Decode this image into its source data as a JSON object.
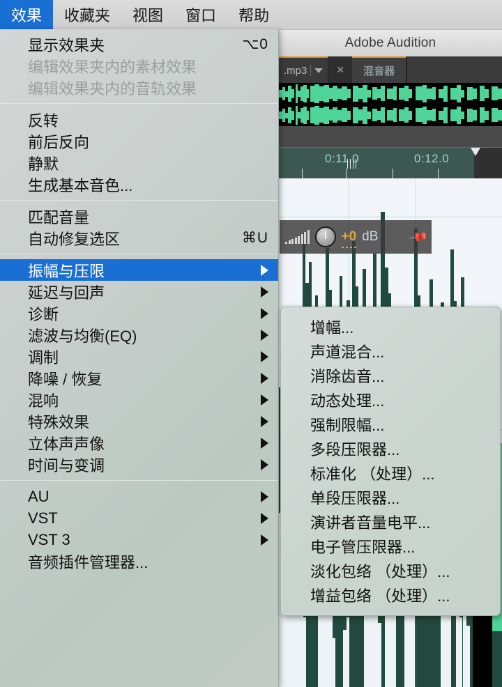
{
  "menubar": {
    "items": [
      {
        "label": "效果",
        "active": true
      },
      {
        "label": "收藏夹",
        "active": false
      },
      {
        "label": "视图",
        "active": false
      },
      {
        "label": "窗口",
        "active": false
      },
      {
        "label": "帮助",
        "active": false
      }
    ]
  },
  "dropdown": {
    "groups": [
      {
        "items": [
          {
            "label": "显示效果夹",
            "shortcut": "⌥0",
            "disabled": false,
            "submenu": false,
            "selected": false
          },
          {
            "label": "编辑效果夹内的素材效果",
            "shortcut": "",
            "disabled": true,
            "submenu": false,
            "selected": false
          },
          {
            "label": "编辑效果夹内的音轨效果",
            "shortcut": "",
            "disabled": true,
            "submenu": false,
            "selected": false
          }
        ]
      },
      {
        "items": [
          {
            "label": "反转",
            "shortcut": "",
            "disabled": false,
            "submenu": false,
            "selected": false
          },
          {
            "label": "前后反向",
            "shortcut": "",
            "disabled": false,
            "submenu": false,
            "selected": false
          },
          {
            "label": "静默",
            "shortcut": "",
            "disabled": false,
            "submenu": false,
            "selected": false
          },
          {
            "label": "生成基本音色...",
            "shortcut": "",
            "disabled": false,
            "submenu": false,
            "selected": false
          }
        ]
      },
      {
        "items": [
          {
            "label": "匹配音量",
            "shortcut": "",
            "disabled": false,
            "submenu": false,
            "selected": false
          },
          {
            "label": "自动修复选区",
            "shortcut": "⌘U",
            "disabled": false,
            "submenu": false,
            "selected": false
          }
        ]
      },
      {
        "items": [
          {
            "label": "振幅与压限",
            "shortcut": "",
            "disabled": false,
            "submenu": true,
            "selected": true
          },
          {
            "label": "延迟与回声",
            "shortcut": "",
            "disabled": false,
            "submenu": true,
            "selected": false
          },
          {
            "label": "诊断",
            "shortcut": "",
            "disabled": false,
            "submenu": true,
            "selected": false
          },
          {
            "label": "滤波与均衡(EQ)",
            "shortcut": "",
            "disabled": false,
            "submenu": true,
            "selected": false
          },
          {
            "label": "调制",
            "shortcut": "",
            "disabled": false,
            "submenu": true,
            "selected": false
          },
          {
            "label": "降噪 / 恢复",
            "shortcut": "",
            "disabled": false,
            "submenu": true,
            "selected": false
          },
          {
            "label": "混响",
            "shortcut": "",
            "disabled": false,
            "submenu": true,
            "selected": false
          },
          {
            "label": "特殊效果",
            "shortcut": "",
            "disabled": false,
            "submenu": true,
            "selected": false
          },
          {
            "label": "立体声声像",
            "shortcut": "",
            "disabled": false,
            "submenu": true,
            "selected": false
          },
          {
            "label": "时间与变调",
            "shortcut": "",
            "disabled": false,
            "submenu": true,
            "selected": false
          }
        ]
      },
      {
        "items": [
          {
            "label": "AU",
            "shortcut": "",
            "disabled": false,
            "submenu": true,
            "selected": false
          },
          {
            "label": "VST",
            "shortcut": "",
            "disabled": false,
            "submenu": true,
            "selected": false
          },
          {
            "label": "VST 3",
            "shortcut": "",
            "disabled": false,
            "submenu": true,
            "selected": false
          },
          {
            "label": "音频插件管理器...",
            "shortcut": "",
            "disabled": false,
            "submenu": false,
            "selected": false
          }
        ]
      }
    ]
  },
  "submenu": {
    "parent": "振幅与压限",
    "items": [
      {
        "label": "增幅..."
      },
      {
        "label": "声道混合..."
      },
      {
        "label": "消除齿音..."
      },
      {
        "label": "动态处理..."
      },
      {
        "label": "强制限幅..."
      },
      {
        "label": "多段压限器..."
      },
      {
        "label": "标准化 （处理）..."
      },
      {
        "label": "单段压限器..."
      },
      {
        "label": "演讲者音量电平..."
      },
      {
        "label": "电子管压限器..."
      },
      {
        "label": "淡化包络 （处理）..."
      },
      {
        "label": "增益包络 （处理）..."
      }
    ]
  },
  "app": {
    "title": "Adobe Audition",
    "tabs": [
      {
        "label": ".mp3",
        "type": "file"
      },
      {
        "label": "混音器",
        "type": "panel"
      }
    ],
    "timeline": {
      "labels": [
        "0:11.0",
        "0:12.0"
      ]
    },
    "hud": {
      "value": "+0",
      "unit": "dB",
      "pin_icon": "pushpin-icon",
      "meter_icon": "level-meter-icon",
      "knob_icon": "gain-knob-icon"
    },
    "colors": {
      "accent": "#1a6fd4",
      "tab_highlight": "#e08b1e",
      "waveform_green": "#4fd49a",
      "hud_value": "#e3a53a"
    }
  }
}
